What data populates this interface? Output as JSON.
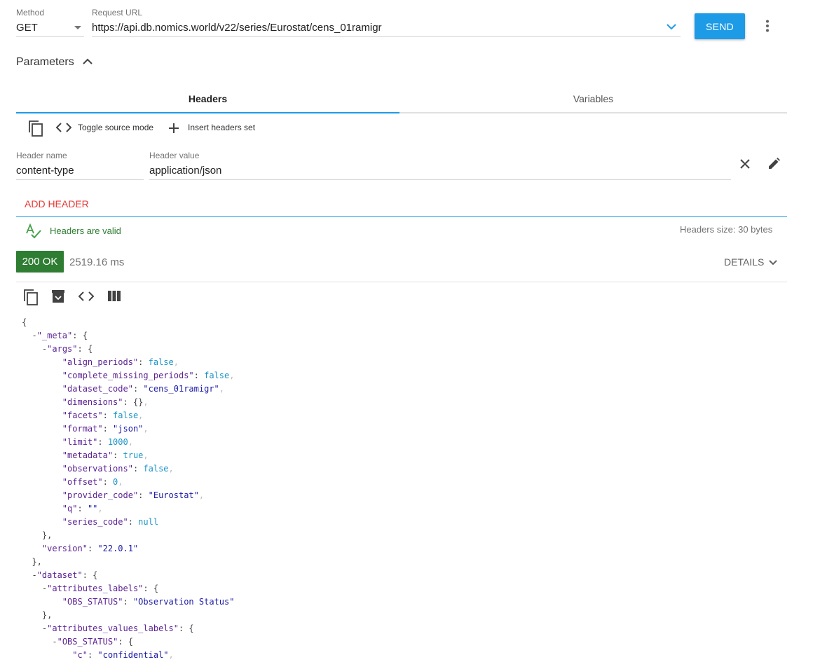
{
  "request": {
    "method_label": "Method",
    "method_value": "GET",
    "url_label": "Request URL",
    "url_value": "https://api.db.nomics.world/v22/series/Eurostat/cens_01ramigr",
    "send_label": "SEND"
  },
  "parameters": {
    "label": "Parameters"
  },
  "tabs": [
    {
      "label": "Headers",
      "active": true
    },
    {
      "label": "Variables",
      "active": false
    }
  ],
  "toolbar": {
    "toggle_label": "Toggle source mode",
    "insert_label": "Insert headers set"
  },
  "header_row": {
    "name_label": "Header name",
    "name_value": "content-type",
    "value_label": "Header value",
    "value_value": "application/json"
  },
  "add_header_label": "ADD HEADER",
  "validation": {
    "valid_text": "Headers are valid",
    "size_text": "Headers size: 30 bytes"
  },
  "response": {
    "status": "200 OK",
    "time": "2519.16 ms",
    "details_label": "DETAILS"
  },
  "colors": {
    "accent": "#1e9be6",
    "success": "#2e7d32",
    "danger": "#e53935"
  },
  "json_lines": [
    [
      [
        "t",
        "{"
      ]
    ],
    [
      [
        "t",
        "  "
      ],
      [
        "t",
        "-"
      ],
      [
        "k",
        "\"_meta\""
      ],
      [
        "t",
        ": {"
      ]
    ],
    [
      [
        "t",
        "    "
      ],
      [
        "t",
        "-"
      ],
      [
        "k",
        "\"args\""
      ],
      [
        "t",
        ": {"
      ]
    ],
    [
      [
        "t",
        "        "
      ],
      [
        "k",
        "\"align_periods\""
      ],
      [
        "t",
        ": "
      ],
      [
        "b",
        "false"
      ],
      [
        "p",
        ","
      ]
    ],
    [
      [
        "t",
        "        "
      ],
      [
        "k",
        "\"complete_missing_periods\""
      ],
      [
        "t",
        ": "
      ],
      [
        "b",
        "false"
      ],
      [
        "p",
        ","
      ]
    ],
    [
      [
        "t",
        "        "
      ],
      [
        "k",
        "\"dataset_code\""
      ],
      [
        "t",
        ": "
      ],
      [
        "s",
        "\"cens_01ramigr\""
      ],
      [
        "p",
        ","
      ]
    ],
    [
      [
        "t",
        "        "
      ],
      [
        "k",
        "\"dimensions\""
      ],
      [
        "t",
        ": {}"
      ],
      [
        "p",
        ","
      ]
    ],
    [
      [
        "t",
        "        "
      ],
      [
        "k",
        "\"facets\""
      ],
      [
        "t",
        ": "
      ],
      [
        "b",
        "false"
      ],
      [
        "p",
        ","
      ]
    ],
    [
      [
        "t",
        "        "
      ],
      [
        "k",
        "\"format\""
      ],
      [
        "t",
        ": "
      ],
      [
        "s",
        "\"json\""
      ],
      [
        "p",
        ","
      ]
    ],
    [
      [
        "t",
        "        "
      ],
      [
        "k",
        "\"limit\""
      ],
      [
        "t",
        ": "
      ],
      [
        "n",
        "1000"
      ],
      [
        "p",
        ","
      ]
    ],
    [
      [
        "t",
        "        "
      ],
      [
        "k",
        "\"metadata\""
      ],
      [
        "t",
        ": "
      ],
      [
        "b",
        "true"
      ],
      [
        "p",
        ","
      ]
    ],
    [
      [
        "t",
        "        "
      ],
      [
        "k",
        "\"observations\""
      ],
      [
        "t",
        ": "
      ],
      [
        "b",
        "false"
      ],
      [
        "p",
        ","
      ]
    ],
    [
      [
        "t",
        "        "
      ],
      [
        "k",
        "\"offset\""
      ],
      [
        "t",
        ": "
      ],
      [
        "n",
        "0"
      ],
      [
        "p",
        ","
      ]
    ],
    [
      [
        "t",
        "        "
      ],
      [
        "k",
        "\"provider_code\""
      ],
      [
        "t",
        ": "
      ],
      [
        "s",
        "\"Eurostat\""
      ],
      [
        "p",
        ","
      ]
    ],
    [
      [
        "t",
        "        "
      ],
      [
        "k",
        "\"q\""
      ],
      [
        "t",
        ": "
      ],
      [
        "s",
        "\"\""
      ],
      [
        "p",
        ","
      ]
    ],
    [
      [
        "t",
        "        "
      ],
      [
        "k",
        "\"series_code\""
      ],
      [
        "t",
        ": "
      ],
      [
        "b",
        "null"
      ]
    ],
    [
      [
        "t",
        "    },"
      ]
    ],
    [
      [
        "t",
        "    "
      ],
      [
        "k",
        "\"version\""
      ],
      [
        "t",
        ": "
      ],
      [
        "s",
        "\"22.0.1\""
      ]
    ],
    [
      [
        "t",
        "  },"
      ]
    ],
    [
      [
        "t",
        "  "
      ],
      [
        "t",
        "-"
      ],
      [
        "k",
        "\"dataset\""
      ],
      [
        "t",
        ": {"
      ]
    ],
    [
      [
        "t",
        "    "
      ],
      [
        "t",
        "-"
      ],
      [
        "k",
        "\"attributes_labels\""
      ],
      [
        "t",
        ": {"
      ]
    ],
    [
      [
        "t",
        "        "
      ],
      [
        "k",
        "\"OBS_STATUS\""
      ],
      [
        "t",
        ": "
      ],
      [
        "s",
        "\"Observation Status\""
      ]
    ],
    [
      [
        "t",
        "    },"
      ]
    ],
    [
      [
        "t",
        "    "
      ],
      [
        "t",
        "-"
      ],
      [
        "k",
        "\"attributes_values_labels\""
      ],
      [
        "t",
        ": {"
      ]
    ],
    [
      [
        "t",
        "      "
      ],
      [
        "t",
        "-"
      ],
      [
        "k",
        "\"OBS_STATUS\""
      ],
      [
        "t",
        ": {"
      ]
    ],
    [
      [
        "t",
        "          "
      ],
      [
        "k",
        "\"c\""
      ],
      [
        "t",
        ": "
      ],
      [
        "s",
        "\"confidential\""
      ],
      [
        "p",
        ","
      ]
    ]
  ]
}
